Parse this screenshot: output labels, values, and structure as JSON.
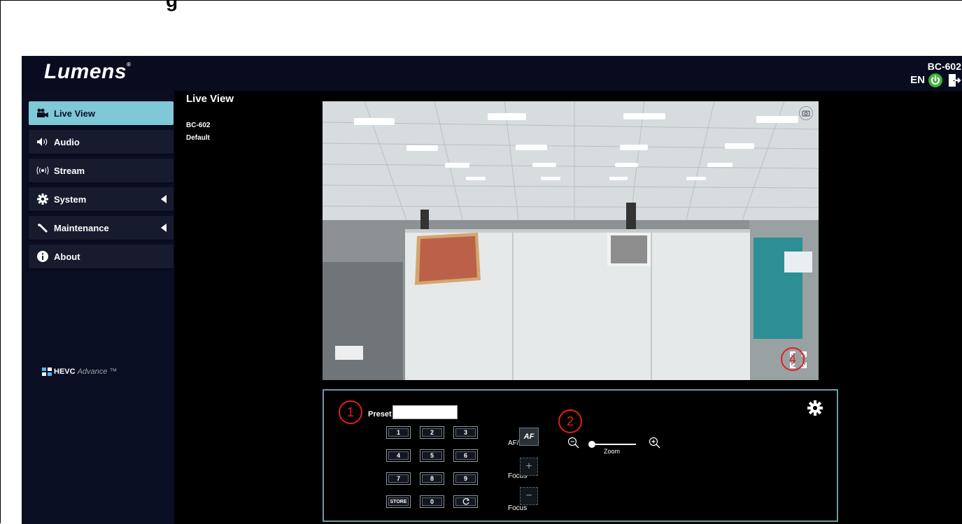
{
  "document": {
    "heading_fragment": "g"
  },
  "header": {
    "brand": "Lumens",
    "brand_mark": "®",
    "model": "BC-602",
    "language": "EN"
  },
  "sidebar": {
    "items": [
      {
        "label": "Live View",
        "icon": "video-camera-icon",
        "active": true
      },
      {
        "label": "Audio",
        "icon": "speaker-icon",
        "active": false
      },
      {
        "label": "Stream",
        "icon": "broadcast-icon",
        "active": false
      },
      {
        "label": "System",
        "icon": "gear-icon",
        "active": false,
        "expandable": true
      },
      {
        "label": "Maintenance",
        "icon": "wrench-icon",
        "active": false,
        "expandable": true
      },
      {
        "label": "About",
        "icon": "info-icon",
        "active": false
      }
    ],
    "footer_logo": {
      "strong": "HEVC",
      "light": "Advance",
      "trademark": "™"
    }
  },
  "main": {
    "title": "Live View",
    "device_name": "BC-602",
    "profile": "Default"
  },
  "controls": {
    "preset_label": "Preset",
    "preset_value": "",
    "keypad": [
      "1",
      "2",
      "3",
      "4",
      "5",
      "6",
      "7",
      "8",
      "9",
      "STORE",
      "0"
    ],
    "afmf_label": "AF/MF",
    "af_button": "AF",
    "focus_label": "Focus",
    "focus_plus": "+",
    "focus_minus": "−",
    "zoom_label": "Zoom",
    "zoom_level": 0
  },
  "annotations": [
    "1",
    "2",
    "4"
  ],
  "colors": {
    "accent": "#7ec8d8",
    "panel_border": "#6c9aa8",
    "power": "#3ab53a",
    "annotation": "#e02020"
  }
}
